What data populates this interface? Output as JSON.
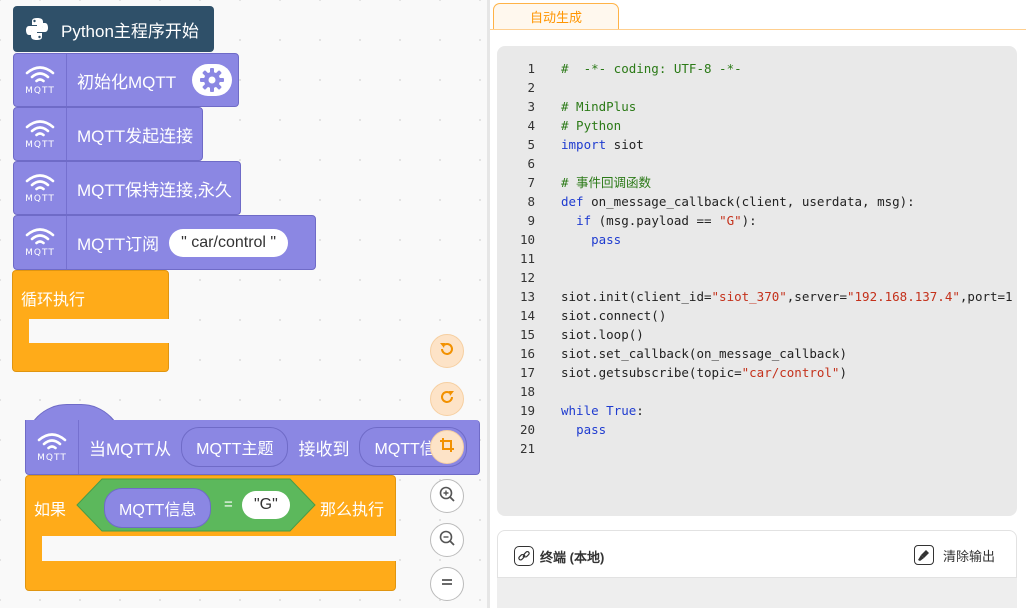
{
  "workspace": {
    "python_start": "Python主程序开始",
    "mqtt_icon_text": "MQTT",
    "init_mqtt": "初始化MQTT",
    "mqtt_connect": "MQTT发起连接",
    "mqtt_keep_alive": "MQTT保持连接,永久",
    "mqtt_subscribe": "MQTT订阅",
    "subscribe_topic": "\" car/control \"",
    "loop_forever": "循环执行",
    "event_when": "当MQTT从",
    "event_topic_param": "MQTT主题",
    "event_received": "接收到",
    "event_msg_param": "MQTT信息",
    "if_label": "如果",
    "if_param": "MQTT信息",
    "if_operator": "=",
    "if_value": "\"G\"",
    "then_label": "那么执行"
  },
  "tabs": {
    "auto_generate": "自动生成"
  },
  "code_lines": [
    {
      "num": "1",
      "segs": [
        {
          "t": "#  -*- coding: UTF-8 -*-",
          "k": "comment"
        }
      ]
    },
    {
      "num": "2",
      "segs": []
    },
    {
      "num": "3",
      "segs": [
        {
          "t": "# MindPlus",
          "k": "comment"
        }
      ]
    },
    {
      "num": "4",
      "segs": [
        {
          "t": "# Python",
          "k": "comment"
        }
      ]
    },
    {
      "num": "5",
      "segs": [
        {
          "t": "import",
          "k": "keyword"
        },
        {
          "t": " siot",
          "k": "plain"
        }
      ]
    },
    {
      "num": "6",
      "segs": []
    },
    {
      "num": "7",
      "segs": [
        {
          "t": "# 事件回调函数",
          "k": "comment"
        }
      ]
    },
    {
      "num": "8",
      "segs": [
        {
          "t": "def",
          "k": "keyword"
        },
        {
          "t": " on_message_callback(client, userdata, msg):",
          "k": "plain"
        }
      ]
    },
    {
      "num": "9",
      "segs": [
        {
          "t": "  ",
          "k": "plain"
        },
        {
          "t": "if",
          "k": "keyword"
        },
        {
          "t": " (msg.payload == ",
          "k": "plain"
        },
        {
          "t": "\"G\"",
          "k": "string"
        },
        {
          "t": "):",
          "k": "plain"
        }
      ]
    },
    {
      "num": "10",
      "segs": [
        {
          "t": "    ",
          "k": "plain"
        },
        {
          "t": "pass",
          "k": "keyword"
        }
      ]
    },
    {
      "num": "11",
      "segs": []
    },
    {
      "num": "12",
      "segs": []
    },
    {
      "num": "13",
      "segs": [
        {
          "t": "siot.init(client_id=",
          "k": "plain"
        },
        {
          "t": "\"siot_370\"",
          "k": "string"
        },
        {
          "t": ",server=",
          "k": "plain"
        },
        {
          "t": "\"192.168.137.4\"",
          "k": "string"
        },
        {
          "t": ",port=1",
          "k": "plain"
        }
      ]
    },
    {
      "num": "14",
      "segs": [
        {
          "t": "siot.connect()",
          "k": "plain"
        }
      ]
    },
    {
      "num": "15",
      "segs": [
        {
          "t": "siot.loop()",
          "k": "plain"
        }
      ]
    },
    {
      "num": "16",
      "segs": [
        {
          "t": "siot.set_callback(on_message_callback)",
          "k": "plain"
        }
      ]
    },
    {
      "num": "17",
      "segs": [
        {
          "t": "siot.getsubscribe(topic=",
          "k": "plain"
        },
        {
          "t": "\"car/control\"",
          "k": "string"
        },
        {
          "t": ")",
          "k": "plain"
        }
      ]
    },
    {
      "num": "18",
      "segs": []
    },
    {
      "num": "19",
      "segs": [
        {
          "t": "while",
          "k": "keyword"
        },
        {
          "t": " ",
          "k": "plain"
        },
        {
          "t": "True",
          "k": "keyword"
        },
        {
          "t": ":",
          "k": "plain"
        }
      ]
    },
    {
      "num": "20",
      "segs": [
        {
          "t": "  ",
          "k": "plain"
        },
        {
          "t": "pass",
          "k": "keyword"
        }
      ]
    },
    {
      "num": "21",
      "segs": []
    }
  ],
  "terminal": {
    "title": "终端 (本地)",
    "clear_label": "清除输出"
  },
  "icons": {
    "python": "python-logo-icon",
    "mqtt": "wifi-icon",
    "settings": "gear-icon",
    "undo": "undo-icon",
    "redo": "redo-icon",
    "crop": "crop-icon",
    "zoom_in": "zoom-in-icon",
    "zoom_out": "zoom-out-icon",
    "reset": "equals-icon",
    "terminal": "link-icon",
    "clear": "broom-icon"
  },
  "colors": {
    "python_block": "#2f5069",
    "mqtt_block": "#8b87e3",
    "control_block": "#ffab19",
    "logic_block": "#5cb85c",
    "accent": "#ff9500",
    "code_keyword": "#1f3cd0",
    "code_comment": "#2b7a17",
    "code_string": "#c4311b"
  }
}
